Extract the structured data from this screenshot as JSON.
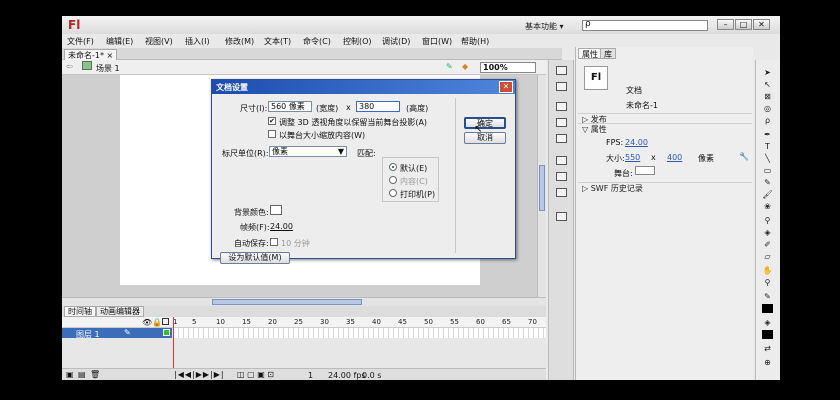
{
  "app": {
    "logo": "Fl",
    "workspace": "基本功能 ▾",
    "search_placeholder": "ρ"
  },
  "window_controls": {
    "minimize": "–",
    "maximize": "□",
    "close": "✕"
  },
  "menu": [
    "文件(F)",
    "编辑(E)",
    "视图(V)",
    "插入(I)",
    "修改(M)",
    "文本(T)",
    "命令(C)",
    "控制(O)",
    "调试(D)",
    "窗口(W)",
    "帮助(H)"
  ],
  "doc_tab": "未命名-1* ×",
  "editbar": {
    "scene": "场景 1",
    "zoom": "100%"
  },
  "dialog": {
    "title": "文档设置",
    "size_label": "尺寸(I):",
    "width_value": "560 像素",
    "width_label": "(宽度)",
    "times": "x",
    "height_value": "380",
    "height_label": "(高度)",
    "adjust_3d": "调整 3D 透视角度以保留当前舞台投影(A)",
    "scale_content": "以舞台大小缩放内容(W)",
    "ruler_label": "标尺单位(R):",
    "ruler_value": "像素",
    "match_label": "匹配:",
    "match_options": [
      "默认(E)",
      "内容(C)",
      "打印机(P)"
    ],
    "bg_label": "背景颜色:",
    "fps_label": "帧频(F):",
    "fps_value": "24.00",
    "autosave_label": "自动保存:",
    "autosave_value": "10 分钟",
    "set_default": "设为默认值(M)",
    "ok": "确定",
    "cancel": "取消"
  },
  "properties": {
    "tabs": [
      "属性",
      "库"
    ],
    "doc_type": "文档",
    "doc_name": "未命名-1",
    "publish": "发布",
    "attributes": "属性",
    "fps_label": "FPS:",
    "fps_value": "24.00",
    "size_label": "大小:",
    "size_w": "550",
    "size_x": "x",
    "size_h": "400",
    "size_unit": "像素",
    "stage_label": "舞台:",
    "swf_history": "SWF 历史记录"
  },
  "timeline": {
    "tabs": [
      "时间轴",
      "动画编辑器"
    ],
    "layer": "图层 1",
    "ticks": [
      "1",
      "5",
      "10",
      "15",
      "20",
      "25",
      "30",
      "35",
      "40",
      "45",
      "50",
      "55",
      "60",
      "65",
      "70"
    ],
    "footer_frame": "1",
    "footer_fps": "24.00 fps",
    "footer_time": "0.0 s"
  }
}
